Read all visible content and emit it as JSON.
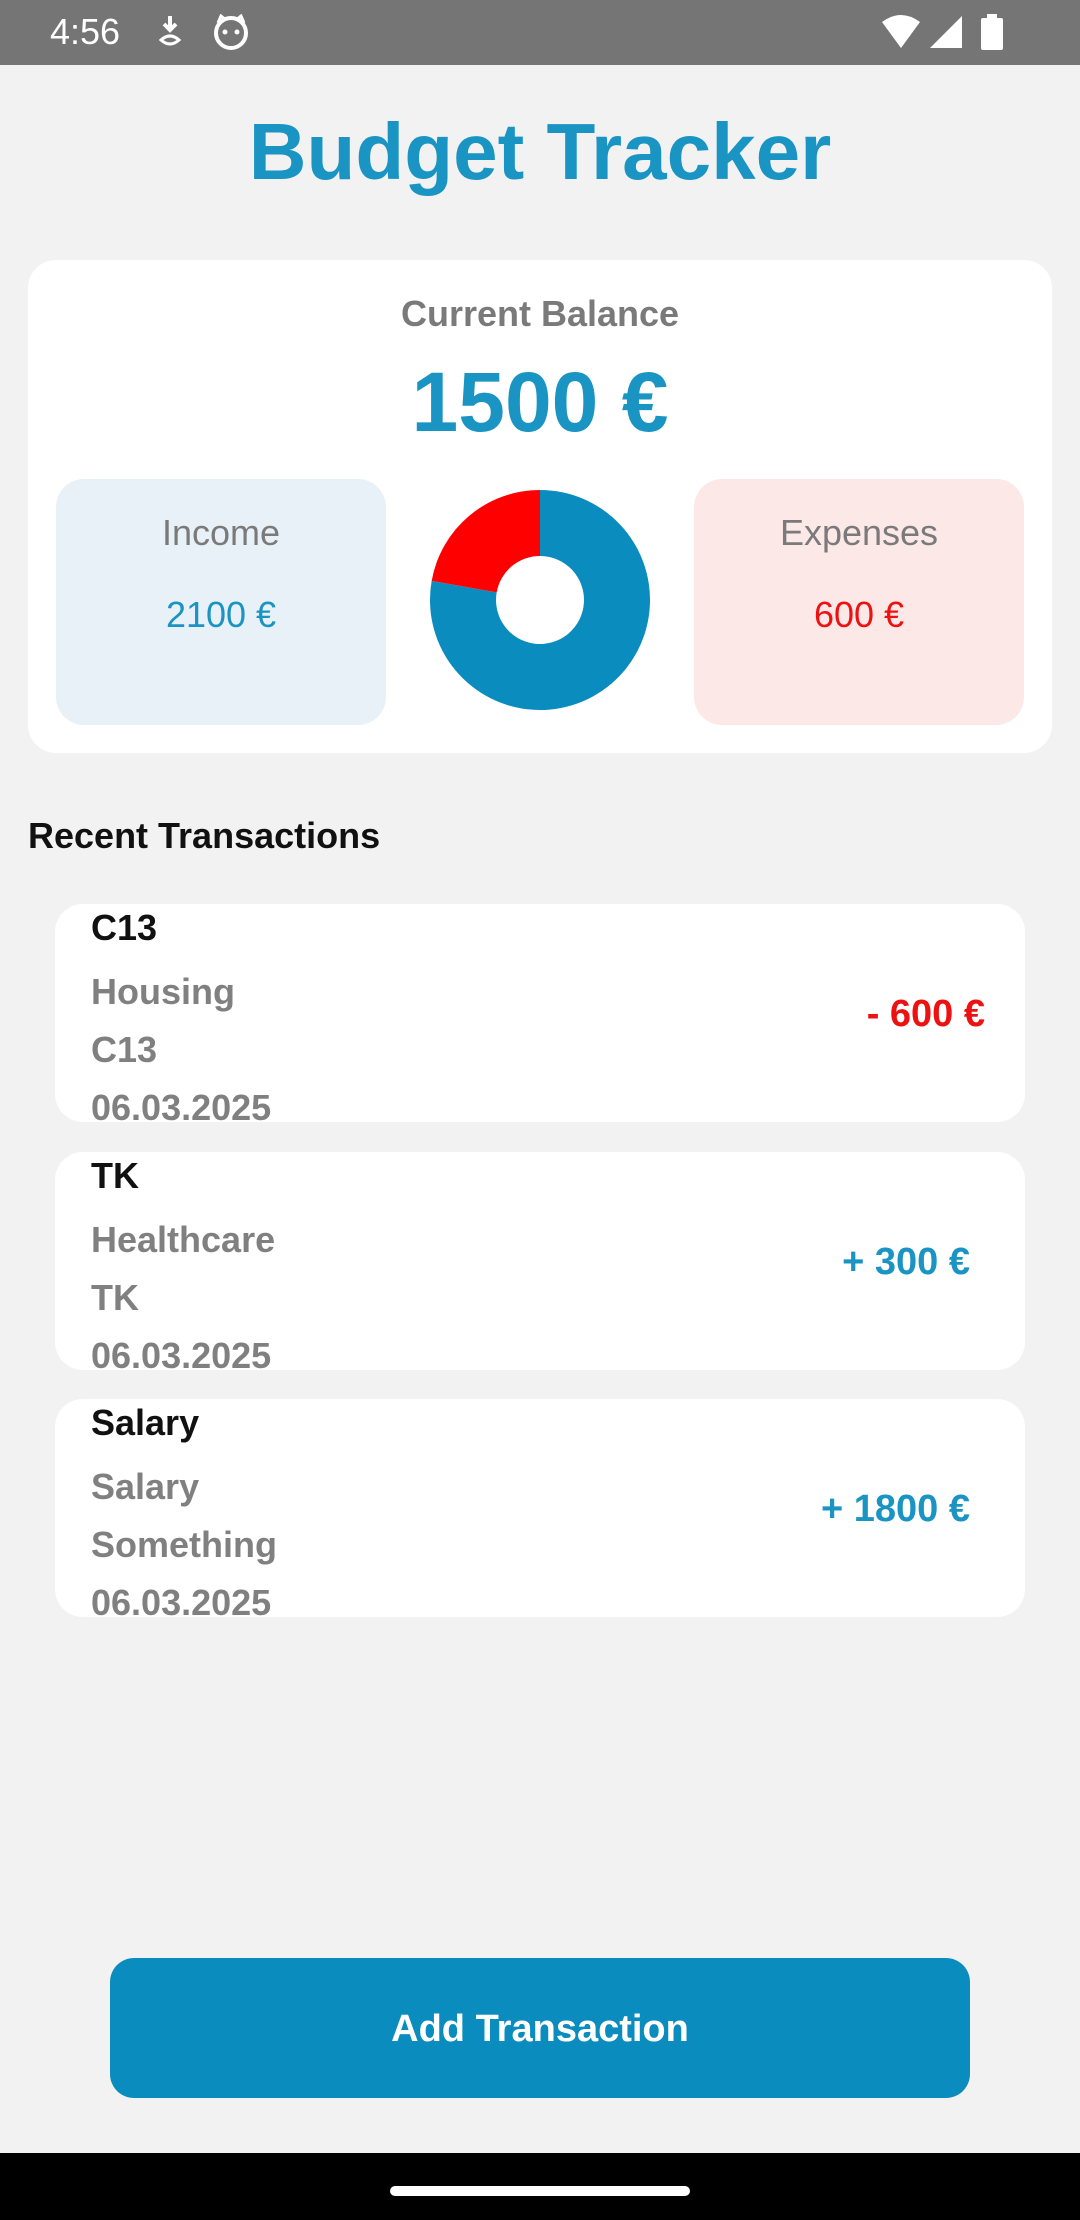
{
  "status_bar": {
    "time": "4:56",
    "left_icons": [
      "download-icon",
      "cat-face-icon"
    ],
    "right_icons": [
      "wifi-icon",
      "cellular-signal-icon",
      "battery-icon"
    ]
  },
  "header": {
    "title": "Budget Tracker"
  },
  "balance": {
    "label": "Current Balance",
    "amount": "1500 €",
    "income": {
      "label": "Income",
      "value": "2100 €",
      "color": "#1a94c2"
    },
    "expenses": {
      "label": "Expenses",
      "value": "600 €",
      "color": "#ee1111"
    }
  },
  "chart_data": {
    "type": "pie",
    "categories": [
      "Income",
      "Expenses"
    ],
    "values": [
      2100,
      600
    ],
    "colors": [
      "#0a8cbf",
      "#ff0000"
    ],
    "donut": true
  },
  "transactions": {
    "section_title": "Recent Transactions",
    "items": [
      {
        "title": "C13",
        "category": "Housing",
        "description": "C13",
        "date": "06.03.2025",
        "amount": "- 600 €",
        "amount_color": "#ee1111"
      },
      {
        "title": "TK",
        "category": "Healthcare",
        "description": "TK",
        "date": "06.03.2025",
        "amount": "+ 300 €",
        "amount_color": "#1a94c2"
      },
      {
        "title": "Salary",
        "category": "Salary",
        "description": "Something",
        "date": "06.03.2025",
        "amount": "+ 1800 €",
        "amount_color": "#1a94c2"
      }
    ]
  },
  "actions": {
    "add_transaction_label": "Add Transaction"
  },
  "colors": {
    "accent": "#1a94c2",
    "button": "#0a8cbf",
    "expense": "#ee1111",
    "background": "#f2f2f2"
  }
}
